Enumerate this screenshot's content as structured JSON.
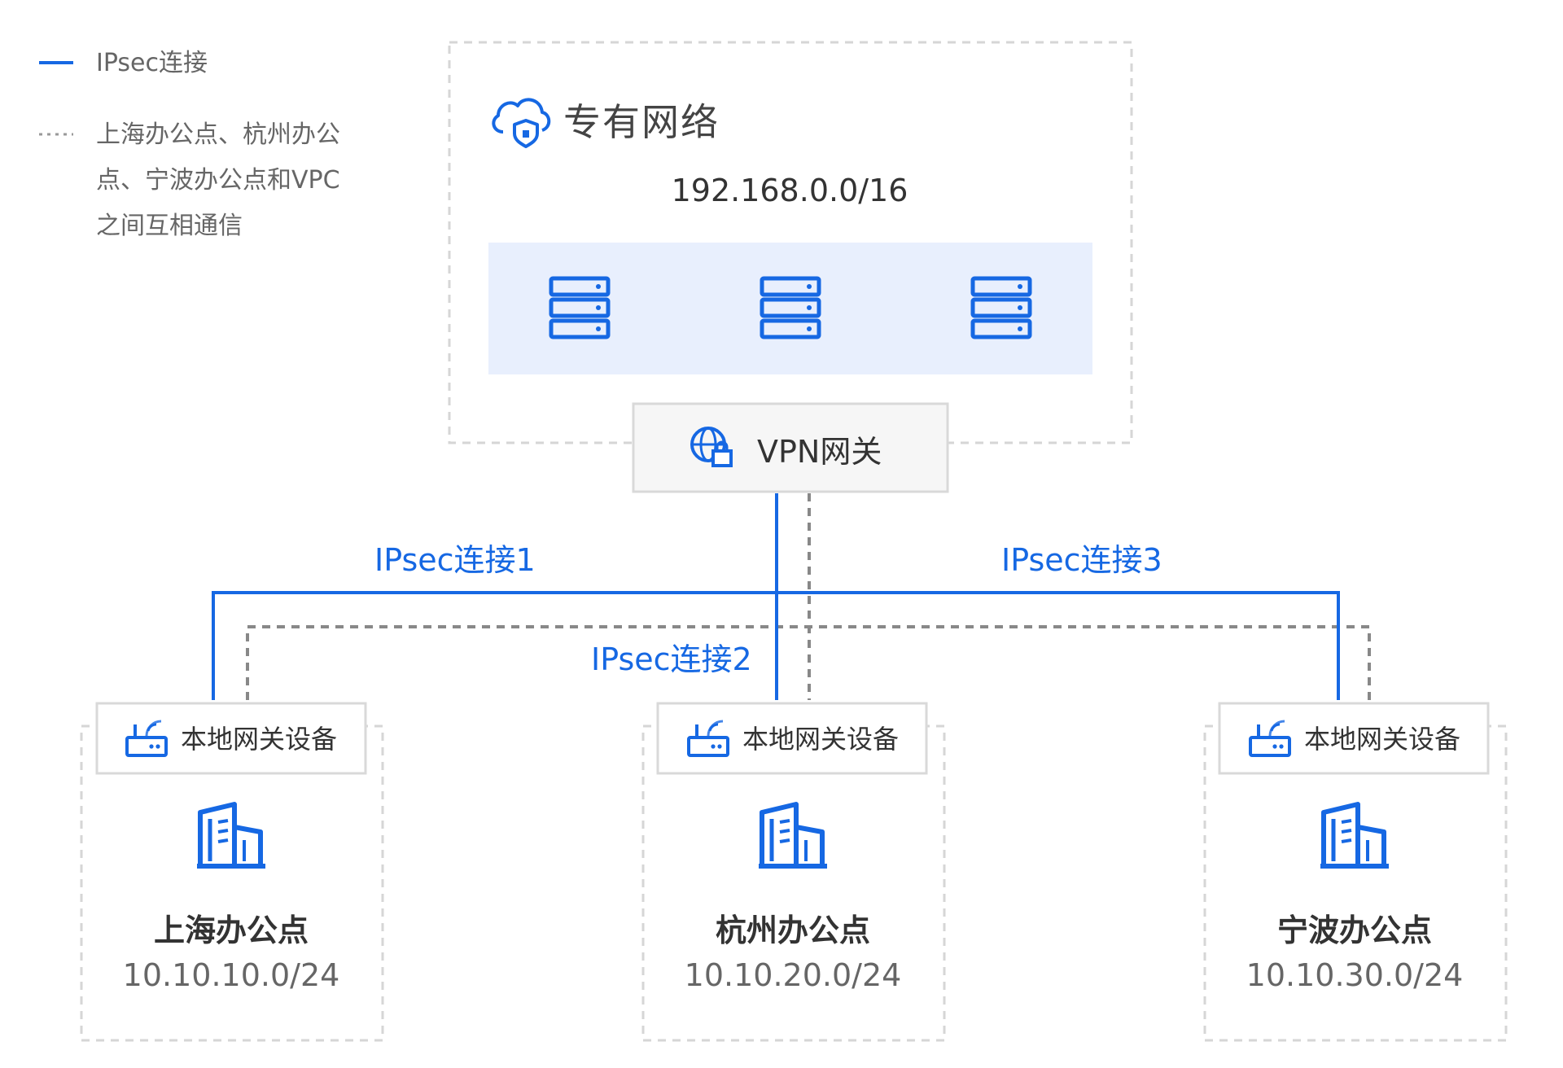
{
  "colors": {
    "ipsec_line": "#1668e3",
    "dotted_line": "#888888",
    "box_border": "#d9d9d9",
    "server_panel": "#e8effd",
    "icon_blue": "#1668e3"
  },
  "legend": {
    "ipsec_label": "IPsec连接",
    "dotted_label": "上海办公点、杭州办公\n点、宁波办公点和VPC\n之间互相通信"
  },
  "vpc": {
    "icon": "cloud-shield-icon",
    "title": "专有网络",
    "cidr": "192.168.0.0/16",
    "server_icon": "server-rack-icon",
    "server_count": 3
  },
  "vpn_gateway": {
    "icon": "globe-lock-icon",
    "label": "VPN网关"
  },
  "connections": [
    {
      "label": "IPsec连接1"
    },
    {
      "label": "IPsec连接2"
    },
    {
      "label": "IPsec连接3"
    }
  ],
  "offices": [
    {
      "gateway_label": "本地网关设备",
      "name": "上海办公点",
      "cidr": "10.10.10.0/24"
    },
    {
      "gateway_label": "本地网关设备",
      "name": "杭州办公点",
      "cidr": "10.10.20.0/24"
    },
    {
      "gateway_label": "本地网关设备",
      "name": "宁波办公点",
      "cidr": "10.10.30.0/24"
    }
  ]
}
